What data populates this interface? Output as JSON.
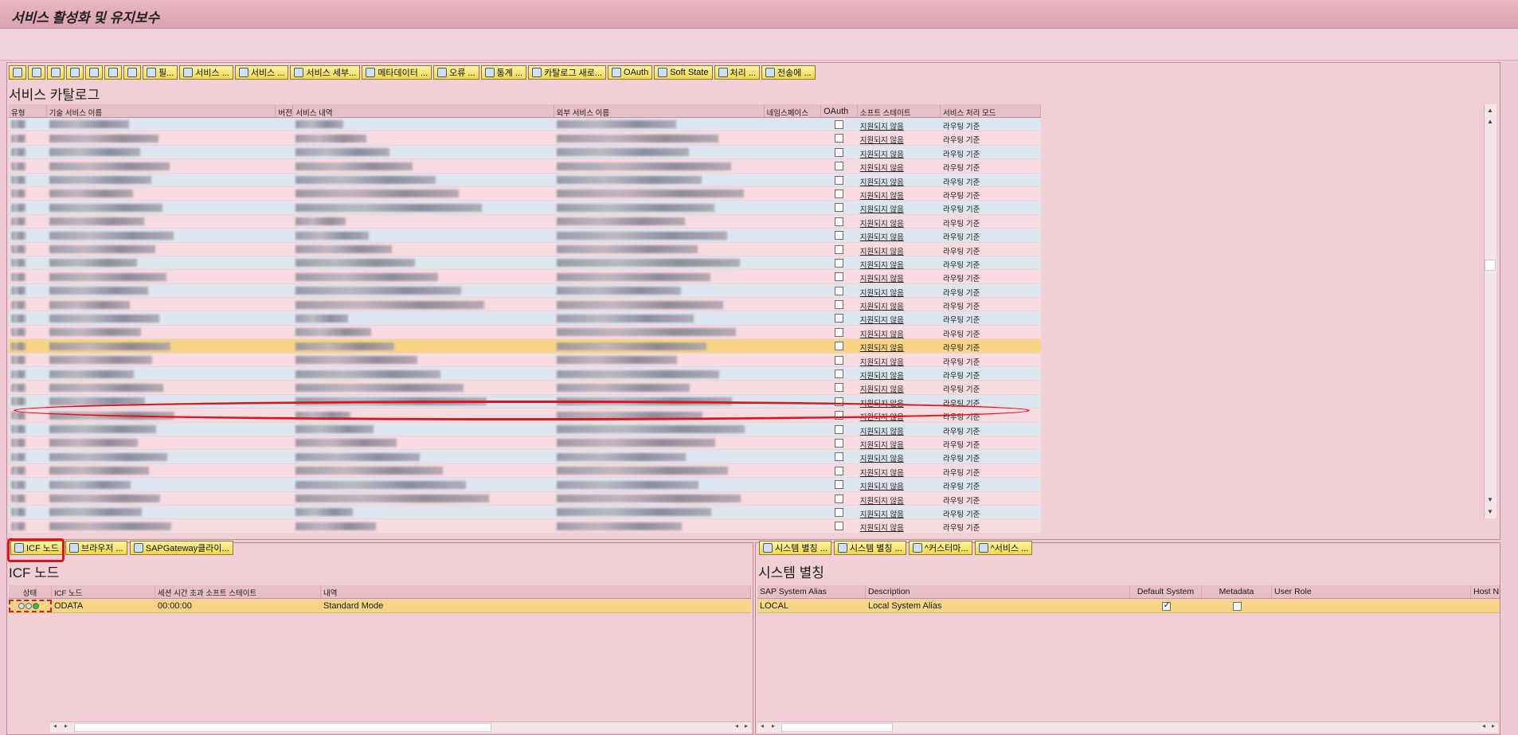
{
  "window": {
    "title": "서비스 활성화 및 유지보수"
  },
  "toolbar": {
    "buttons": [
      "필...",
      "서비스 ...",
      "서비스 ...",
      "서비스 세부...",
      "메타데이터 ...",
      "오류 ...",
      "통계 ...",
      "카탈로그 새로...",
      "OAuth",
      "Soft State",
      "처리 ...",
      "전송에 ..."
    ]
  },
  "catalog": {
    "title": "서비스 카탈로그",
    "columns": [
      "유형",
      "기술 서비스 이름",
      "버전",
      "서비스 내역",
      "외부 서비스 이름",
      "네임스페이스",
      "OAuth",
      "소프트 스테이트",
      "서비스 처리 모드"
    ],
    "row_soft_state": "지원되지 않음",
    "row_mode": "라우팅 기준"
  },
  "icf": {
    "title": "ICF 노드",
    "toolbar": [
      "ICF 노드",
      "브라우저 ...",
      "SAPGateway클라이..."
    ],
    "columns": [
      "상태",
      "ICF 노드",
      "세션 시간 초과 소프트 스테이트",
      "내역"
    ],
    "row": {
      "node": "ODATA",
      "timeout": "00:00:00",
      "desc": "Standard Mode"
    }
  },
  "alias": {
    "title": "시스템 별칭",
    "toolbar": [
      "시스템 별칭 ...",
      "시스템 별칭 ...",
      "^커스터마...",
      "^서비스 ..."
    ],
    "columns": [
      "SAP System Alias",
      "Description",
      "Default System",
      "Metadata",
      "User Role",
      "Host Na"
    ],
    "row": {
      "alias": "LOCAL",
      "desc": "Local System Alias",
      "default": true,
      "metadata": false
    }
  }
}
